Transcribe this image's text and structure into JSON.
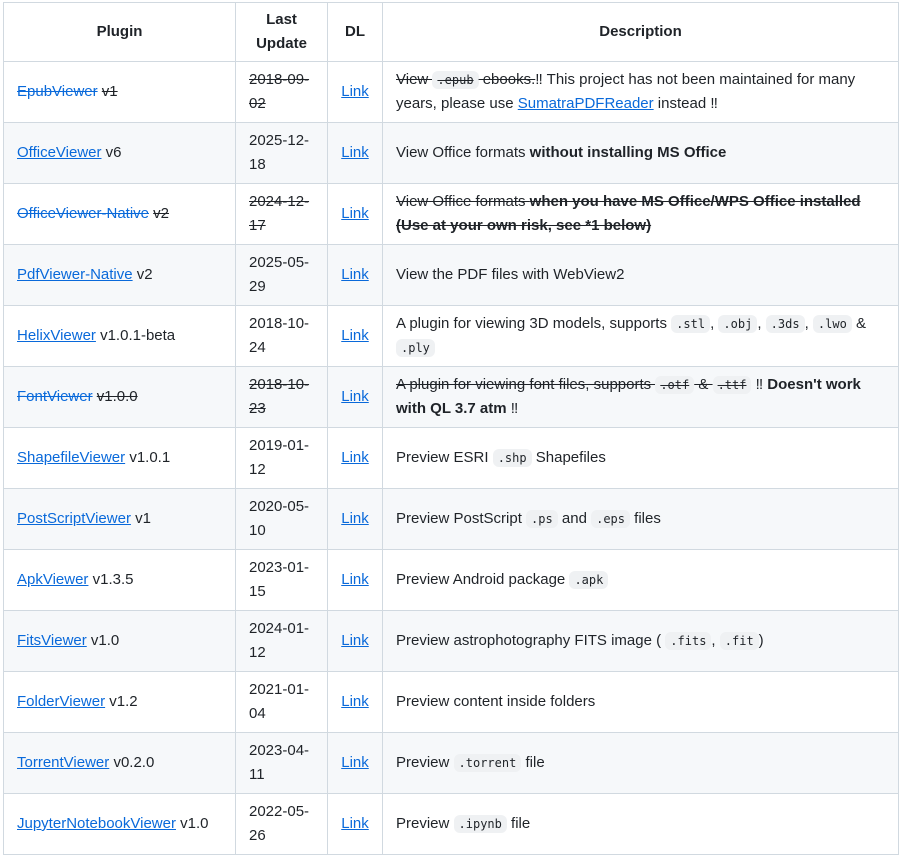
{
  "headers": {
    "plugin": "Plugin",
    "last_update": "Last Update",
    "dl": "DL",
    "description": "Description"
  },
  "link_label": "Link",
  "rows": [
    {
      "name": "EpubViewer",
      "version": "v1",
      "date": "2018-09-02",
      "deprecated": true,
      "desc": [
        {
          "t": "View "
        },
        {
          "code": ".epub"
        },
        {
          "t": " ebooks."
        }
      ],
      "desc2": [
        {
          "bang": "‼"
        },
        {
          "t": " This project has not been maintained for many years, please use "
        },
        {
          "link": "SumatraPDFReader"
        },
        {
          "t": " instead "
        },
        {
          "bang": "‼"
        }
      ]
    },
    {
      "name": "OfficeViewer",
      "version": "v6",
      "date": "2025-12-18",
      "deprecated": false,
      "desc": [
        {
          "t": "View Office formats "
        },
        {
          "b": "without installing MS Office"
        }
      ]
    },
    {
      "name": "OfficeViewer-Native",
      "version": "v2",
      "date": "2024-12-17",
      "deprecated": true,
      "desc": [
        {
          "t": "View Office formats "
        },
        {
          "b": "when you have MS Office/WPS Office installed (Use at your own risk, see *1 below)"
        }
      ]
    },
    {
      "name": "PdfViewer-Native",
      "version": "v2",
      "date": "2025-05-29",
      "deprecated": false,
      "desc": [
        {
          "t": "View the PDF files with WebView2"
        }
      ]
    },
    {
      "name": "HelixViewer",
      "version": "v1.0.1-beta",
      "date": "2018-10-24",
      "deprecated": false,
      "desc": [
        {
          "t": "A plugin for viewing 3D models, supports "
        },
        {
          "code": ".stl"
        },
        {
          "t": ", "
        },
        {
          "code": ".obj"
        },
        {
          "t": ", "
        },
        {
          "code": ".3ds"
        },
        {
          "t": ", "
        },
        {
          "code": ".lwo"
        },
        {
          "t": " & "
        },
        {
          "code": ".ply"
        }
      ]
    },
    {
      "name": "FontViewer",
      "version": "v1.0.0",
      "date": "2018-10-23",
      "deprecated": true,
      "version_strike": true,
      "desc": [
        {
          "t": "A plugin for viewing font files, supports "
        },
        {
          "code": ".otf"
        },
        {
          "t": " & "
        },
        {
          "code": ".ttf"
        }
      ],
      "desc2": [
        {
          "t": " "
        },
        {
          "bang": "‼"
        },
        {
          "b": " Doesn't work with QL 3.7 atm "
        },
        {
          "bang": "‼"
        }
      ]
    },
    {
      "name": "ShapefileViewer",
      "version": "v1.0.1",
      "date": "2019-01-12",
      "deprecated": false,
      "desc": [
        {
          "t": "Preview ESRI "
        },
        {
          "code": ".shp"
        },
        {
          "t": " Shapefiles"
        }
      ]
    },
    {
      "name": "PostScriptViewer",
      "version": "v1",
      "date": "2020-05-10",
      "deprecated": false,
      "desc": [
        {
          "t": "Preview PostScript "
        },
        {
          "code": ".ps"
        },
        {
          "t": " and "
        },
        {
          "code": ".eps"
        },
        {
          "t": " files"
        }
      ]
    },
    {
      "name": "ApkViewer",
      "version": "v1.3.5",
      "date": "2023-01-15",
      "deprecated": false,
      "desc": [
        {
          "t": "Preview Android package "
        },
        {
          "code": ".apk"
        }
      ]
    },
    {
      "name": "FitsViewer",
      "version": "v1.0",
      "date": "2024-01-12",
      "deprecated": false,
      "desc": [
        {
          "t": "Preview astrophotography FITS image ( "
        },
        {
          "code": ".fits"
        },
        {
          "t": ", "
        },
        {
          "code": ".fit"
        },
        {
          "t": ")"
        }
      ]
    },
    {
      "name": "FolderViewer",
      "version": "v1.2",
      "date": "2021-01-04",
      "deprecated": false,
      "desc": [
        {
          "t": "Preview content inside folders"
        }
      ]
    },
    {
      "name": "TorrentViewer",
      "version": "v0.2.0",
      "date": "2023-04-11",
      "deprecated": false,
      "desc": [
        {
          "t": "Preview "
        },
        {
          "code": ".torrent"
        },
        {
          "t": " file"
        }
      ]
    },
    {
      "name": "JupyterNotebookViewer",
      "version": "v1.0",
      "date": "2022-05-26",
      "deprecated": false,
      "desc": [
        {
          "t": "Preview "
        },
        {
          "code": ".ipynb"
        },
        {
          "t": " file"
        }
      ]
    }
  ]
}
